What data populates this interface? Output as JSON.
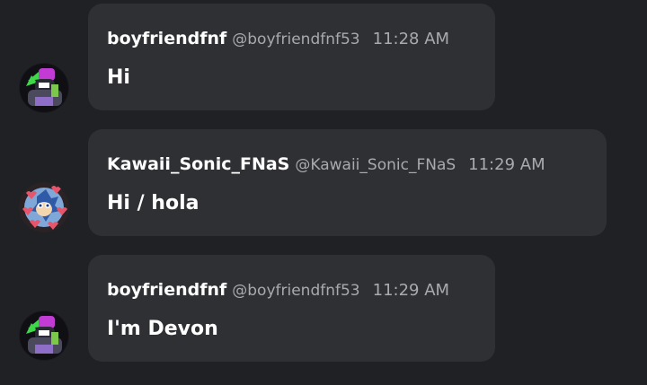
{
  "messages": [
    {
      "username": "boyfriendfnf",
      "handle": "@boyfriendfnf53",
      "time": "11:28 AM",
      "text": "Hi",
      "avatar_icon": "boyfriend-avatar-icon"
    },
    {
      "username": "Kawaii_Sonic_FNaS",
      "handle": "@Kawaii_Sonic_FNaS",
      "time": "11:29 AM",
      "text": "Hi / hola",
      "avatar_icon": "sonic-hearts-avatar-icon"
    },
    {
      "username": "boyfriendfnf",
      "handle": "@boyfriendfnf53",
      "time": "11:29 AM",
      "text": "I'm Devon",
      "avatar_icon": "boyfriend-avatar-icon"
    }
  ],
  "colors": {
    "background": "#202124",
    "bubble": "#2e3033",
    "name": "#ffffff",
    "muted": "#a8aaad"
  }
}
